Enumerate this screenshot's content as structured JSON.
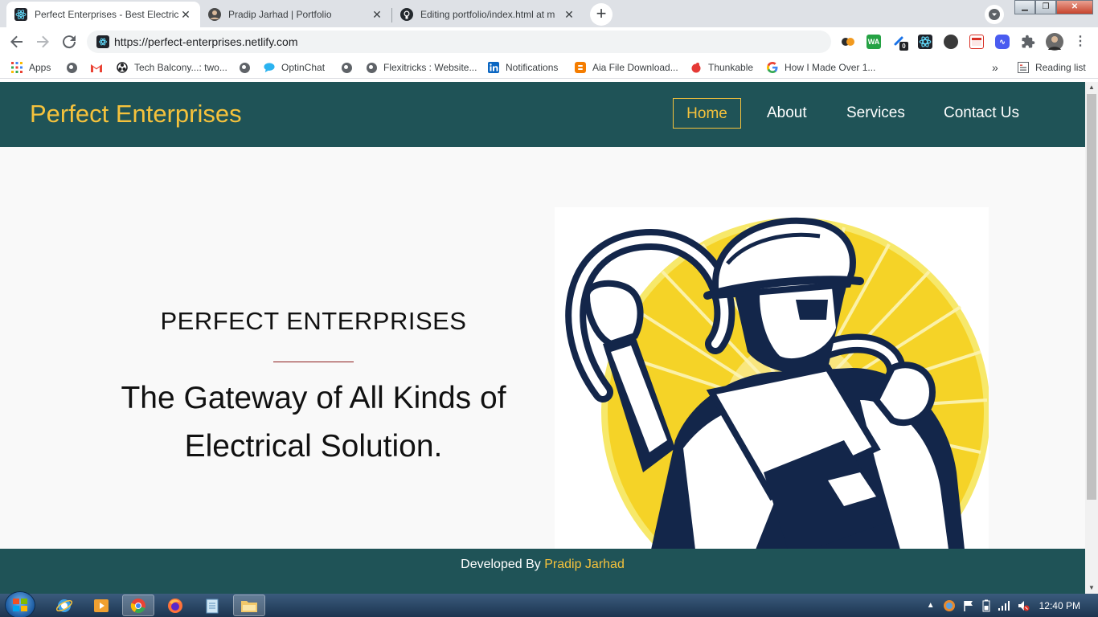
{
  "browser": {
    "tabs": [
      {
        "title": "Perfect Enterprises - Best Electric",
        "active": true
      },
      {
        "title": "Pradip Jarhad | Portfolio",
        "active": false
      },
      {
        "title": "Editing portfolio/index.html at m",
        "active": false
      }
    ],
    "url": "https://perfect-enterprises.netlify.com",
    "extension_badge": "0",
    "bookmarks": [
      "Apps",
      "",
      "",
      "Tech Balcony...: two...",
      "",
      "OptinChat",
      "",
      "Flexitricks : Website...",
      "Notifications",
      "Aia File Download...",
      "Thunkable",
      "How I Made Over 1..."
    ],
    "overflow": "»",
    "reading_list": "Reading list"
  },
  "site": {
    "brand": "Perfect Enterprises",
    "nav": [
      "Home",
      "About",
      "Services",
      "Contact Us"
    ],
    "hero_title": "PERFECT ENTERPRISES",
    "hero_line1": "The Gateway of All Kinds of",
    "hero_line2": "Electrical Solution.",
    "footer_prefix": "Developed By",
    "footer_name": "Pradip Jarhad"
  },
  "taskbar": {
    "clock": "12:40 PM"
  },
  "colors": {
    "nav_bg": "#1f5357",
    "accent": "#f5c23c",
    "divider": "#8b1a1a",
    "illustration_navy": "#13264a",
    "illustration_yellow": "#f5d327"
  },
  "icons": {
    "tab1": "react-icon",
    "tab2": "avatar-icon",
    "tab3": "github-icon",
    "illustration": "electrician-with-cable-illustration"
  }
}
